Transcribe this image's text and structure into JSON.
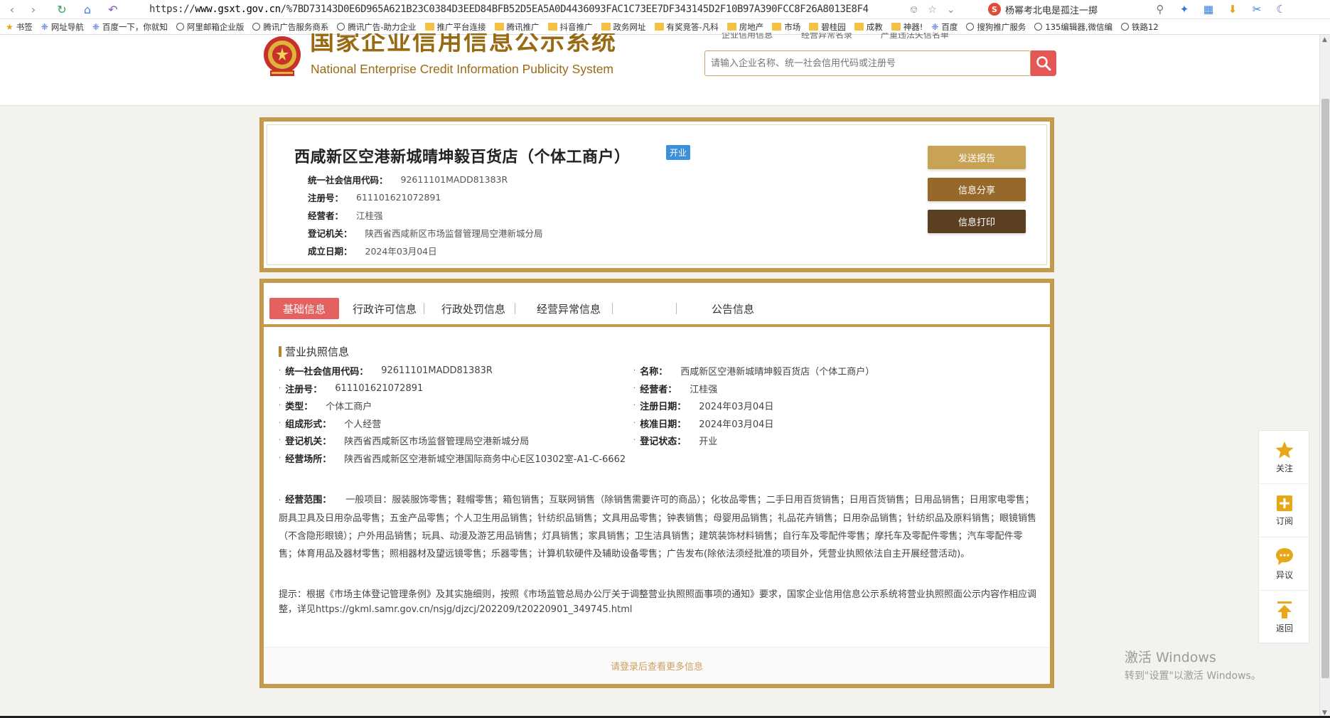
{
  "browser": {
    "url_prefix": "https://",
    "url_host": "www.gsxt.gov.cn",
    "url_path": "/%7BD73143D0E6D965A621B23C0384D3EED84BFB52D5EA5A0D4436093FAC1C73EE7DF343145D2F10B97A390FCC8F26A8013E8F4",
    "search_hint": "杨幂考北电是孤注一掷",
    "bookmarks": [
      {
        "icon": "star-icon",
        "label": "书签"
      },
      {
        "icon": "paw-icon",
        "label": "网址导航"
      },
      {
        "icon": "paw-icon",
        "label": "百度一下，你就知"
      },
      {
        "icon": "globe-icon",
        "label": "阿里邮箱企业版"
      },
      {
        "icon": "globe-icon",
        "label": "腾讯广告服务商系"
      },
      {
        "icon": "globe-icon",
        "label": "腾讯广告-助力企业"
      },
      {
        "icon": "folder-icon",
        "label": "推广平台连接"
      },
      {
        "icon": "folder-icon",
        "label": "腾讯推广"
      },
      {
        "icon": "folder-icon",
        "label": "抖音推广"
      },
      {
        "icon": "folder-icon",
        "label": "政务网址"
      },
      {
        "icon": "folder-icon",
        "label": "有奖竞答-凡科"
      },
      {
        "icon": "folder-icon",
        "label": "房地产"
      },
      {
        "icon": "folder-icon",
        "label": "市场"
      },
      {
        "icon": "folder-icon",
        "label": "碧桂园"
      },
      {
        "icon": "folder-icon",
        "label": "成教"
      },
      {
        "icon": "folder-icon",
        "label": "神器!"
      },
      {
        "icon": "paw-icon",
        "label": "百度"
      },
      {
        "icon": "globe-icon",
        "label": "搜狗推广服务"
      },
      {
        "icon": "globe-icon",
        "label": "135编辑器,微信编"
      },
      {
        "icon": "globe-icon",
        "label": "铁路12"
      }
    ]
  },
  "header": {
    "logo_cn": "国家企业信用信息公示系统",
    "logo_en": "National Enterprise Credit Information Publicity System",
    "top_links": [
      "企业信用信息",
      "经营异常名录",
      "严重违法失信名单"
    ],
    "search_placeholder": "请输入企业名称、统一社会信用代码或注册号"
  },
  "company": {
    "name": "西咸新区空港新城晴坤毅百货店（个体工商户）",
    "status": "开业",
    "rows": [
      {
        "label": "统一社会信用代码：",
        "value": "92611101MADD81383R"
      },
      {
        "label": "注册号：",
        "value": "611101621072891"
      },
      {
        "label": "经营者：",
        "value": "江桂强"
      },
      {
        "label": "登记机关：",
        "value": "陕西省西咸新区市场监督管理局空港新城分局"
      },
      {
        "label": "成立日期：",
        "value": "2024年03月04日"
      }
    ],
    "buttons": {
      "report": "发送报告",
      "share": "信息分享",
      "print": "信息打印"
    }
  },
  "tabs": [
    "基础信息",
    "行政许可信息",
    "行政处罚信息",
    "经营异常信息",
    "公告信息"
  ],
  "license": {
    "title": "营业执照信息",
    "left": [
      {
        "label": "统一社会信用代码：",
        "value": "92611101MADD81383R"
      },
      {
        "label": "注册号：",
        "value": "611101621072891"
      },
      {
        "label": "类型：",
        "value": "个体工商户"
      },
      {
        "label": "组成形式：",
        "value": "个人经营"
      },
      {
        "label": "登记机关：",
        "value": "陕西省西咸新区市场监督管理局空港新城分局"
      },
      {
        "label": "经营场所：",
        "value": "陕西省西咸新区空港新城空港国际商务中心E区10302室-A1-C-6662"
      }
    ],
    "right": [
      {
        "label": "名称：",
        "value": "西咸新区空港新城晴坤毅百货店（个体工商户）"
      },
      {
        "label": "经营者：",
        "value": "江桂强"
      },
      {
        "label": "注册日期：",
        "value": "2024年03月04日"
      },
      {
        "label": "核准日期：",
        "value": "2024年03月04日"
      },
      {
        "label": "登记状态：",
        "value": "开业"
      }
    ],
    "scope_label": "经营范围：",
    "scope_value": "一般项目：服装服饰零售；鞋帽零售；箱包销售；互联网销售（除销售需要许可的商品）；化妆品零售；二手日用百货销售；日用百货销售；日用品销售；日用家电零售；厨具卫具及日用杂品零售；五金产品零售；个人卫生用品销售；针纺织品销售；文具用品零售；钟表销售；母婴用品销售；礼品花卉销售；日用杂品销售；针纺织品及原料销售；眼镜销售（不含隐形眼镜）；户外用品销售；玩具、动漫及游艺用品销售；灯具销售；家具销售；卫生洁具销售；建筑装饰材料销售；自行车及零配件零售；摩托车及零配件零售；汽车零配件零售；体育用品及器材零售；照相器材及望远镜零售；乐器零售；计算机软硬件及辅助设备零售；广告发布(除依法须经批准的项目外，凭营业执照依法自主开展经营活动)。",
    "tip": "提示：根据《市场主体登记管理条例》及其实施细则，按照《市场监管总局办公厅关于调整营业执照照面事项的通知》要求，国家企业信用信息公示系统将营业执照照面公示内容作相应调整，详见https://gkml.samr.gov.cn/nsjg/djzcj/202209/t20220901_349745.html",
    "login_text": "请登录后查看更多信息"
  },
  "side_tools": [
    {
      "icon": "star-icon",
      "label": "关注"
    },
    {
      "icon": "plus-icon",
      "label": "订阅"
    },
    {
      "icon": "comment-icon",
      "label": "异议"
    },
    {
      "icon": "arrow-up-icon",
      "label": "返回"
    }
  ],
  "watermark": {
    "line1": "激活 Windows",
    "line2": "转到\"设置\"以激活 Windows。"
  },
  "colors": {
    "gold": "#c49a4d",
    "tab_active": "#e5615f",
    "status_blue": "#3d8fd9",
    "search_red": "#e45755"
  }
}
